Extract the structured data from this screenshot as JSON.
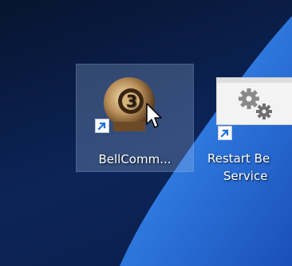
{
  "desktop": {
    "icons": [
      {
        "label": "BellComm...",
        "icon": "bellcomm-app-icon",
        "selected": true,
        "shortcut_overlay": "shortcut-arrow-icon"
      },
      {
        "label_line1": "Restart Be",
        "label_line2": "Service",
        "icon": "gears-icon",
        "selected": false,
        "shortcut_overlay": "shortcut-arrow-icon"
      }
    ]
  },
  "colors": {
    "desktop_background": "#0b1a3a",
    "wallpaper_beam": "#2f7ae0",
    "selection_highlight": "#a0bee6"
  }
}
